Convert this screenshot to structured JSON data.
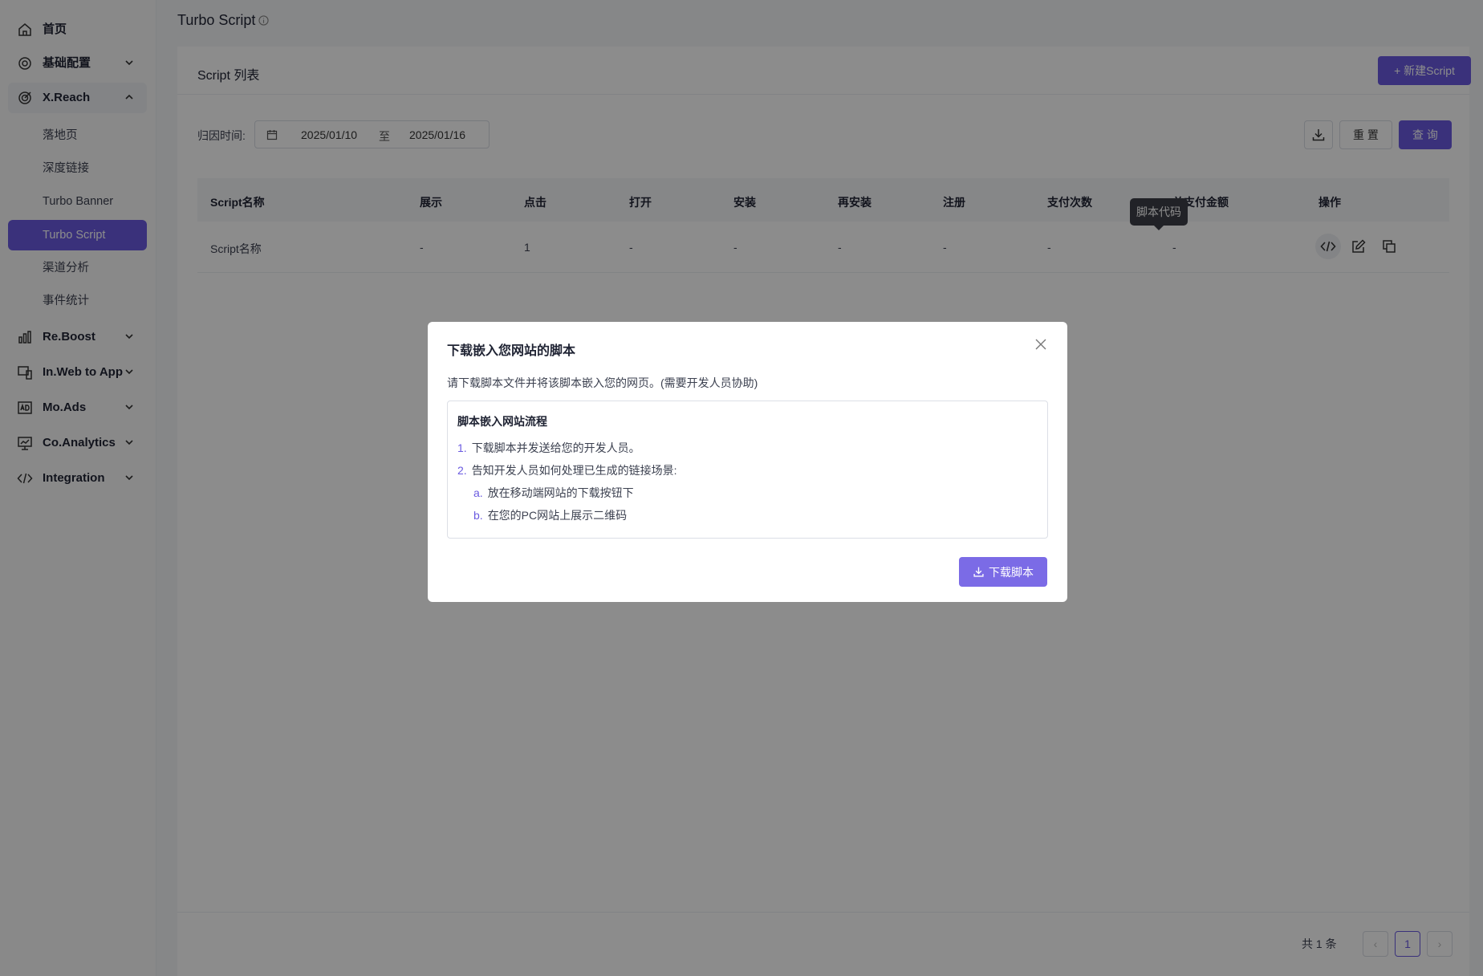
{
  "sidebar": {
    "items": [
      {
        "label": "首页",
        "icon": "home-icon"
      },
      {
        "label": "基础配置",
        "icon": "settings-icon"
      },
      {
        "label": "X.Reach",
        "icon": "target-icon"
      },
      {
        "label": "Re.Boost",
        "icon": "bar-chart-icon"
      },
      {
        "label": "In.Web to App",
        "icon": "devices-icon"
      },
      {
        "label": "Mo.Ads",
        "icon": "ad-icon"
      },
      {
        "label": "Co.Analytics",
        "icon": "analytics-icon"
      },
      {
        "label": "Integration",
        "icon": "code-icon"
      }
    ],
    "xreach_sub": [
      "落地页",
      "深度链接",
      "Turbo Banner",
      "Turbo Script",
      "渠道分析",
      "事件统计"
    ],
    "active_sub": "Turbo Script"
  },
  "page": {
    "title": "Turbo Script"
  },
  "card": {
    "title": "Script 列表",
    "new_button": "+ 新建Script"
  },
  "filter": {
    "label": "归因时间:",
    "start_date": "2025/01/10",
    "separator": "至",
    "end_date": "2025/01/16",
    "reset_button": "重 置",
    "query_button": "查 询"
  },
  "table": {
    "headers": [
      "Script名称",
      "展示",
      "点击",
      "打开",
      "安装",
      "再安装",
      "注册",
      "支付次数",
      "总支付金额",
      "操作"
    ],
    "rows": [
      [
        "Script名称",
        "-",
        "1",
        "-",
        "-",
        "-",
        "-",
        "-",
        "-"
      ]
    ]
  },
  "tooltip": "脚本代码",
  "pagination": {
    "total": "共 1 条",
    "current": "1",
    "prev": "‹",
    "next": "›"
  },
  "modal": {
    "title": "下载嵌入您网站的脚本",
    "description": "请下载脚本文件并将该脚本嵌入您的网页。(需要开发人员协助)",
    "steps_title": "脚本嵌入网站流程",
    "steps": [
      {
        "num": "1.",
        "text": "下载脚本并发送给您的开发人员。"
      },
      {
        "num": "2.",
        "text": "告知开发人员如何处理已生成的链接场景:"
      },
      {
        "num": "a.",
        "text": "放在移动端网站的下载按钮下"
      },
      {
        "num": "b.",
        "text": "在您的PC网站上展示二维码"
      }
    ],
    "download_button": "下载脚本"
  },
  "colors": {
    "accent": "#6a5ae0",
    "mask": "rgba(0,0,0,0.45)"
  }
}
